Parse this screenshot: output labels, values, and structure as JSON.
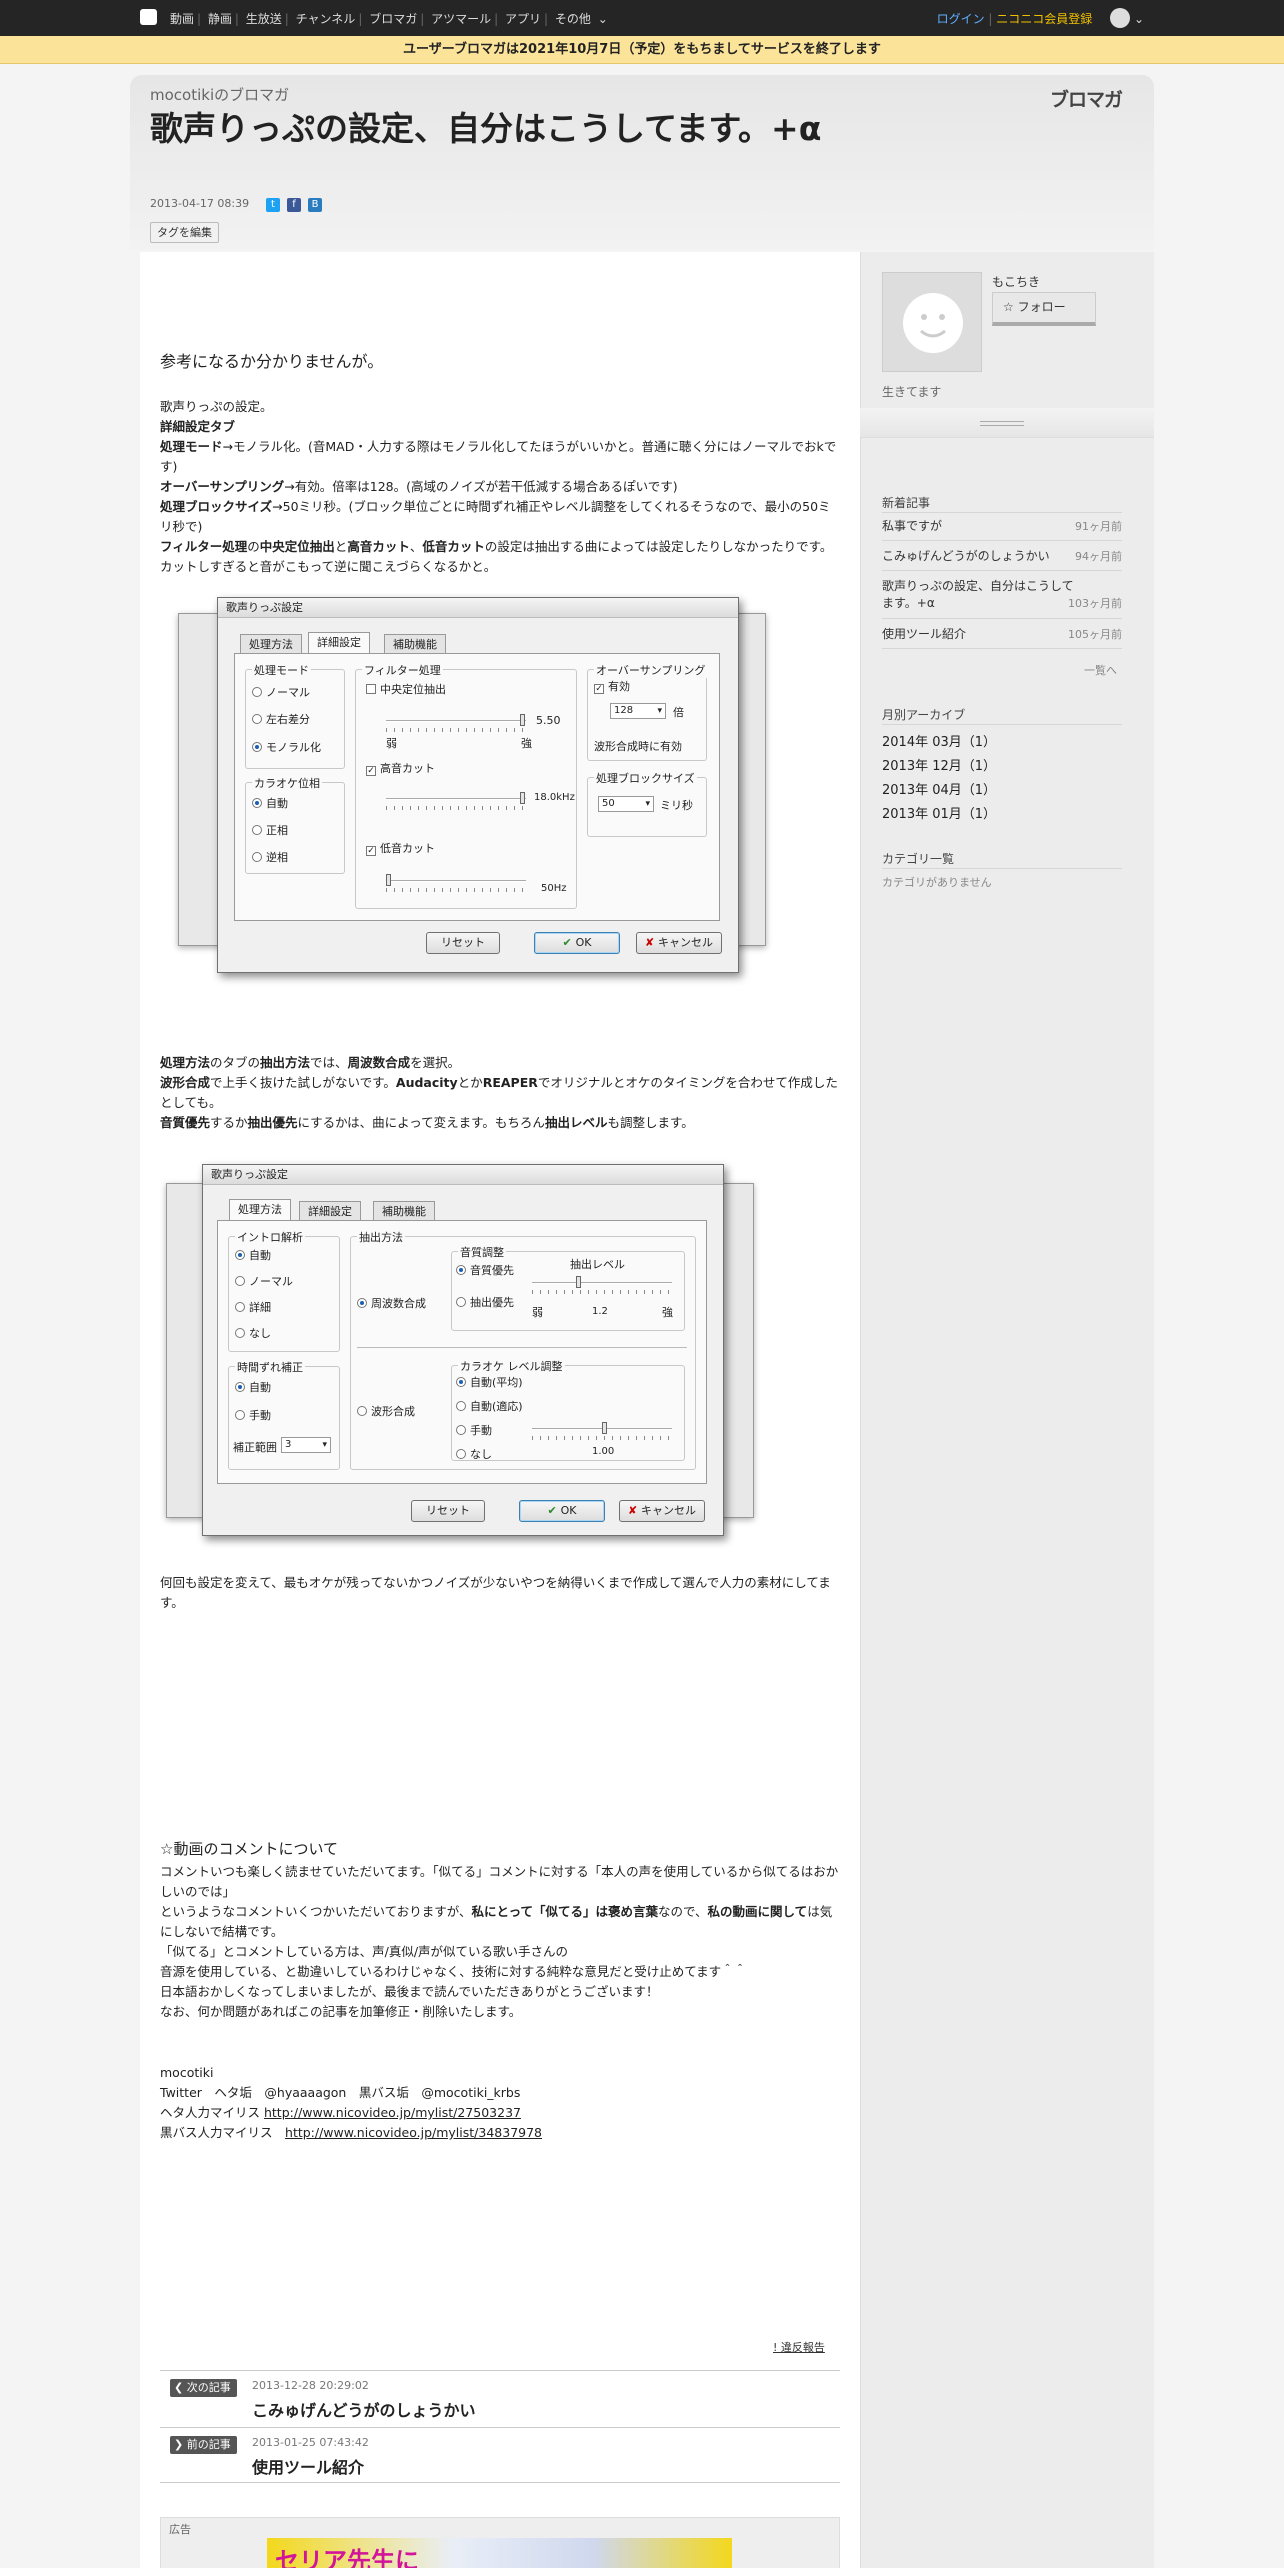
{
  "gnav": {
    "items": [
      "動画",
      "静画",
      "生放送",
      "チャンネル",
      "ブロマガ",
      "アツマール",
      "アプリ",
      "その他"
    ],
    "login": "ログイン",
    "register": "ニコニコ会員登録"
  },
  "notice": "ユーザーブロマガは2021年10月7日（予定）をもちましてサービスを終了します",
  "header": {
    "blog_name": "mocotikiのブロマガ",
    "brand": "ブロマガ",
    "title": "歌声りっぷの設定、自分はこうしてます。+α",
    "date": "2013-04-17 08:39",
    "tag_button": "タグを編集"
  },
  "article": {
    "lead": "参考になるか分かりませんが。",
    "p1_0": "歌声りっぷの設定。",
    "p1_1": "詳細設定タブ",
    "p1_2b": "処理モード",
    "p1_2": "→モノラル化。(音MAD・人力する際はモノラル化してたほうがいいかと。普通に聴く分にはノーマルでおkです)",
    "p1_3b": "オーバーサンプリング",
    "p1_3": "→有効。倍率は128。(高域のノイズが若干低減する場合あるぽいです)",
    "p1_4b": "処理ブロックサイズ",
    "p1_4": "→50ミリ秒。(ブロック単位ごとに時間ずれ補正やレベル調整をしてくれるそうなので、最小の50ミリ秒で)",
    "p1_5a": "フィルター処理",
    "p1_5b": "の",
    "p1_5c": "中央定位抽出",
    "p1_5d": "と",
    "p1_5e": "高音カット",
    "p1_5f": "、",
    "p1_5g": "低音カット",
    "p1_5h": "の設定は抽出する曲によっては設定したりしなかったりです。カットしすぎると音がこもって逆に聞こえづらくなるかと。",
    "p2_1a": "処理方法",
    "p2_1b": "のタブの",
    "p2_1c": "抽出方法",
    "p2_1d": "では、",
    "p2_1e": "周波数合成",
    "p2_1f": "を選択。",
    "p2_2a": "波形合成",
    "p2_2b": "で上手く抜けた試しがないです。",
    "p2_2c": "Audacity",
    "p2_2d": "とか",
    "p2_2e": "REAPER",
    "p2_2f": "でオリジナルとオケのタイミングを合わせて作成したとしても。",
    "p2_3a": "音質優先",
    "p2_3b": "するか",
    "p2_3c": "抽出優先",
    "p2_3d": "にするかは、曲によって変えます。もちろん",
    "p2_3e": "抽出レベル",
    "p2_3f": "も調整します。",
    "p3": "何回も設定を変えて、最もオケが残ってないかつノイズが少ないやつを納得いくまで作成して選んで人力の素材にしてます。",
    "sec_title": "☆動画のコメントについて",
    "c1": "コメントいつも楽しく読ませていただいてます。「似てる」コメントに対する「本人の声を使用しているから似てるはおかしいのでは」",
    "c2a": "というようなコメントいくつかいただいておりますが、",
    "c2b": "私にとって「似てる」は褒め言葉",
    "c2c": "なので、",
    "c2d": "私の動画に関して",
    "c2e": "は気にしないで結構です。",
    "c3": "「似てる」とコメントしている方は、声/真似/声が似ている歌い手さんの",
    "c4": "音源を使用している、と勘違いしているわけじゃなく、技術に対する純粋な意見だと受け止めてます＾＾",
    "c5": "日本語おかしくなってしまいましたが、最後まで読んでいただきありがとうございます！",
    "c6": "なお、何か問題があればこの記事を加筆修正・削除いたします。",
    "s1": "mocotiki",
    "s2": "Twitter　ヘタ垢　@hyaaaagon　黒バス垢　@mocotiki_krbs",
    "s3a": "ヘタ人力マイリス ",
    "s3b": "http://www.nicovideo.jp/mylist/27503237",
    "s4a": "黒バス人力マイリス　",
    "s4b": "http://www.nicovideo.jp/mylist/34837978",
    "report": "! 違反報告"
  },
  "dialog1": {
    "title": "歌声りっぷ設定",
    "tabs": [
      "処理方法",
      "詳細設定",
      "補助機能"
    ],
    "mode_group": "処理モード",
    "mode_opts": [
      "ノーマル",
      "左右差分",
      "モノラル化"
    ],
    "karaoke_group": "カラオケ位相",
    "karaoke_opts": [
      "自動",
      "正相",
      "逆相"
    ],
    "filter_group": "フィルター処理",
    "center": "中央定位抽出",
    "center_val": "5.50",
    "weak": "弱",
    "strong": "強",
    "highcut": "高音カット",
    "highcut_val": "18.0kHz",
    "lowcut": "低音カット",
    "lowcut_val": "50Hz",
    "over_group": "オーバーサンプリング",
    "over_enable": "有効",
    "over_rate": "128",
    "over_unit": "倍",
    "over_note": "波形合成時に有効",
    "block_group": "処理ブロックサイズ",
    "block_val": "50",
    "block_unit": "ミリ秒",
    "reset": "リセット",
    "ok": "OK",
    "cancel": "キャンセル"
  },
  "dialog2": {
    "title": "歌声りっぷ設定",
    "tabs": [
      "処理方法",
      "詳細設定",
      "補助機能"
    ],
    "intro_group": "イントロ解析",
    "intro_opts": [
      "自動",
      "ノーマル",
      "詳細",
      "なし"
    ],
    "time_group": "時間ずれ補正",
    "time_opts": [
      "自動",
      "手動"
    ],
    "range_label": "補正範囲",
    "range_val": "3",
    "extract_group": "抽出方法",
    "freq": "周波数合成",
    "wave": "波形合成",
    "quality_group": "音質調整",
    "q_opts": [
      "音質優先",
      "抽出優先"
    ],
    "level_label": "抽出レベル",
    "weak": "弱",
    "strong": "強",
    "level_val": "1.2",
    "kara_group": "カラオケ レベル調整",
    "kara_opts": [
      "自動(平均)",
      "自動(適応)",
      "手動",
      "なし"
    ],
    "kara_val": "1.00",
    "reset": "リセット",
    "ok": "OK",
    "cancel": "キャンセル"
  },
  "sidebar": {
    "user": "もこちき",
    "follow": "☆ フォロー",
    "desc": "生きてます",
    "new_title": "新着記事",
    "articles": [
      {
        "t": "私事ですが",
        "ago": "91ヶ月前"
      },
      {
        "t": "こみゅげんどうがのしょうかい",
        "ago": "94ヶ月前"
      },
      {
        "t": "歌声りっぷの設定、自分はこうしてます。+α",
        "ago": "103ヶ月前"
      },
      {
        "t": "使用ツール紹介",
        "ago": "105ヶ月前"
      }
    ],
    "more": "一覧へ",
    "archive_title": "月別アーカイブ",
    "archives": [
      "2014年 03月（1）",
      "2013年 12月（1）",
      "2013年 04月（1）",
      "2013年 01月（1）"
    ],
    "cat_title": "カテゴリ一覧",
    "no_cat": "カテゴリがありません"
  },
  "postnav": {
    "next_label": "次の記事",
    "next_date": "2013-12-28 20:29:02",
    "next_title": "こみゅげんどうがのしょうかい",
    "prev_label": "前の記事",
    "prev_date": "2013-01-25 07:43:42",
    "prev_title": "使用ツール紹介"
  },
  "ad": {
    "label": "広告",
    "banner": "セリア先生に"
  }
}
